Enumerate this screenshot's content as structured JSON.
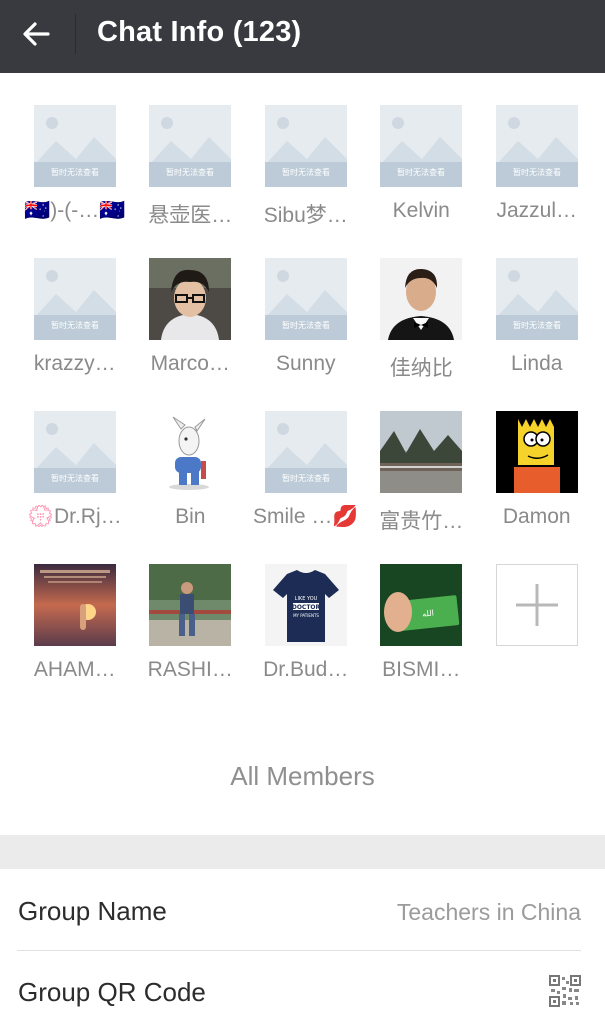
{
  "header": {
    "title": "Chat Info (123)",
    "back_icon": "arrow-left-icon"
  },
  "members": [
    {
      "name": "🇦🇺)-(-…🇦🇺",
      "avatar": "placeholder"
    },
    {
      "name": "悬壶医…",
      "avatar": "placeholder"
    },
    {
      "name": "Sibu梦…",
      "avatar": "placeholder"
    },
    {
      "name": "Kelvin",
      "avatar": "placeholder"
    },
    {
      "name": "Jazzul…",
      "avatar": "placeholder"
    },
    {
      "name": "krazzy…",
      "avatar": "placeholder"
    },
    {
      "name": "Marco…",
      "avatar": "photo-man-glasses"
    },
    {
      "name": "Sunny",
      "avatar": "placeholder"
    },
    {
      "name": "佳纳比",
      "avatar": "photo-man-bowtie"
    },
    {
      "name": "Linda",
      "avatar": "placeholder"
    },
    {
      "name": "💮Dr.Rj…",
      "avatar": "placeholder"
    },
    {
      "name": "Bin",
      "avatar": "cartoon-dog"
    },
    {
      "name": "Smile …💋",
      "avatar": "placeholder"
    },
    {
      "name": "富贵竹…",
      "avatar": "photo-park"
    },
    {
      "name": "Damon",
      "avatar": "cartoon-bart"
    },
    {
      "name": "AHAM…",
      "avatar": "photo-sunset"
    },
    {
      "name": "RASHI…",
      "avatar": "photo-man-bridge"
    },
    {
      "name": "Dr.Bud…",
      "avatar": "photo-doctor-shirt"
    },
    {
      "name": "BISMI…",
      "avatar": "photo-allah-card"
    }
  ],
  "placeholder_text": "暂时无法查看",
  "add_member_icon": "plus-icon",
  "all_members_label": "All Members",
  "settings": {
    "group_name_label": "Group Name",
    "group_name_value": "Teachers in China",
    "qr_label": "Group QR Code",
    "qr_icon": "qr-code-icon"
  },
  "colors": {
    "header_bg": "#393a3f",
    "header_text": "#ffffff",
    "section_gap": "#ebebeb"
  }
}
